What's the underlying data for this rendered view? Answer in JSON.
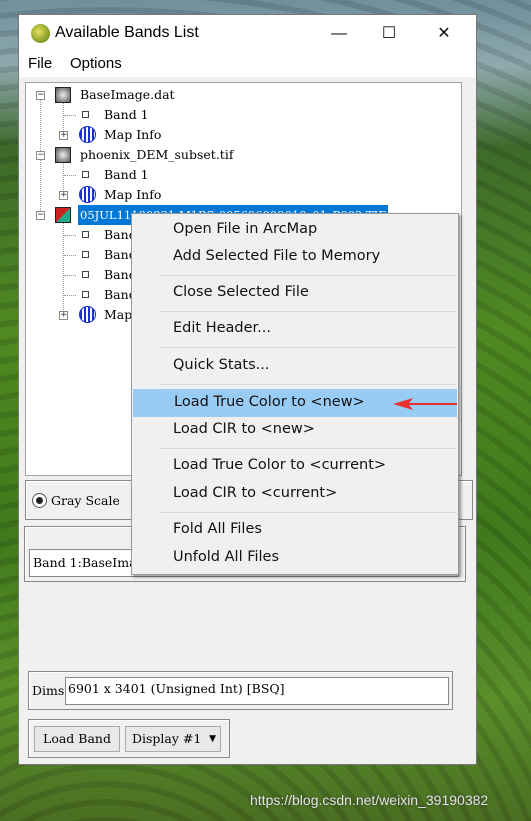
{
  "window": {
    "title": "Available Bands List",
    "minimize": "—",
    "maximize": "☐",
    "close": "✕"
  },
  "menubar": [
    "File",
    "Options"
  ],
  "tree": [
    {
      "label": "BaseImage.dat",
      "children": [
        "Band 1",
        "Map Info"
      ]
    },
    {
      "label": "phoenix_DEM_subset.tif",
      "children": [
        "Band 1",
        "Map Info"
      ]
    },
    {
      "label": "05JUL11180831-M1BS-005696009010_01_P002.TIF",
      "selected": true,
      "children": [
        "Band 1",
        "Band 2",
        "Band 3",
        "Band 4",
        "Map Info"
      ]
    }
  ],
  "radio": {
    "label": "Gray Scale",
    "checked": true
  },
  "selected_band": "Band 1:BaseImage.dat",
  "dims": {
    "label": "Dims",
    "value": "6901 x 3401 (Unsigned Int) [BSQ]"
  },
  "buttons": {
    "load_band": "Load Band",
    "display": "Display #1"
  },
  "context_menu": {
    "items": [
      "Open File in ArcMap",
      "Add Selected File to Memory",
      "Close Selected File",
      "Edit Header...",
      "Quick Stats...",
      "Load True Color to <new>",
      "Load CIR to <new>",
      "Load True Color to <current>",
      "Load CIR to <current>",
      "Fold All Files",
      "Unfold All Files"
    ],
    "highlighted": "Load True Color to <new>"
  },
  "colors": {
    "selection": "#0078d7",
    "menu_highlight": "#99ccf5",
    "annotation_arrow": "#e83030"
  },
  "watermark": "https://blog.csdn.net/weixin_39190382"
}
